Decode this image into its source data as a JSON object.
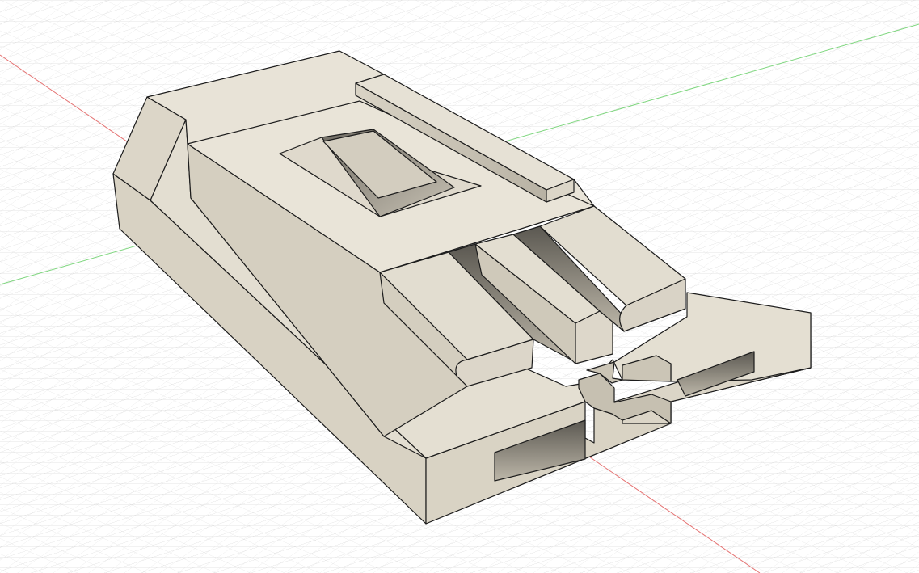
{
  "view": {
    "type": "3d-cad-viewport",
    "background": "#ffffff",
    "grid_minor_color": "#d9d9d9",
    "grid_major_color": "#bdbdbd",
    "axis_x_color": "#e06666",
    "axis_y_color": "#6ccf6c"
  },
  "model": {
    "body_color": "#e2ddd0",
    "top_color": "#e8e3d6",
    "side_color": "#d6d0c1",
    "shadow_color": "#8f8a7f",
    "edge_color": "#1c1c1c"
  }
}
